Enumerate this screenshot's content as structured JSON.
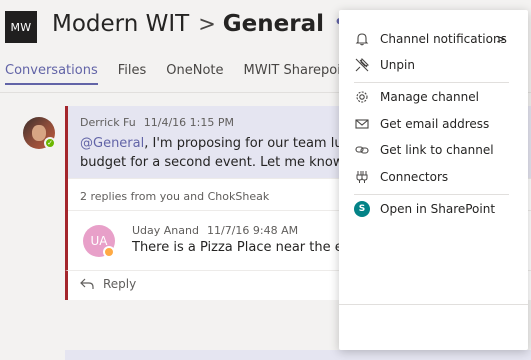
{
  "team": {
    "avatar_text": "MW",
    "name": "Modern WIT",
    "separator": ">",
    "channel": "General",
    "more_label": "•••"
  },
  "tabs": [
    {
      "label": "Conversations",
      "active": true
    },
    {
      "label": "Files"
    },
    {
      "label": "OneNote"
    },
    {
      "label": "MWIT Sharepoint"
    }
  ],
  "tab_overflow_fragment": "8",
  "post": {
    "author": "Derrick Fu",
    "timestamp": "11/4/16 1:15 PM",
    "mention": "@General",
    "line1_rest": ", I'm proposing for our team lunch",
    "line1_clip": " la",
    "line2": "budget for a second event. Let me know w",
    "line2_clip": "p",
    "replies_summary": "2 replies from you and ChokSheak"
  },
  "reply": {
    "avatar_initials": "UA",
    "author": "Uday Anand",
    "timestamp": "11/7/16 9:48 AM",
    "text": "There is a Pizza Place near the eve",
    "clip": "s"
  },
  "reply_button_label": "Reply",
  "menu": {
    "items": [
      {
        "label": "Channel notifications",
        "icon": "bell-icon",
        "chevron": ">"
      },
      {
        "label": "Unpin",
        "icon": "unpin-icon"
      },
      {
        "label": "Manage channel",
        "icon": "gear-icon"
      },
      {
        "label": "Get email address",
        "icon": "envelope-icon"
      },
      {
        "label": "Get link to channel",
        "icon": "link-icon"
      },
      {
        "label": "Connectors",
        "icon": "connectors-icon"
      },
      {
        "label": "Open in SharePoint",
        "icon": "sharepoint-icon",
        "icon_letter": "S"
      }
    ]
  },
  "colors": {
    "accent": "#6264a7",
    "thread_border": "#a4262c",
    "available": "#6bb700",
    "away": "#ffaa44",
    "sharepoint": "#038387"
  }
}
